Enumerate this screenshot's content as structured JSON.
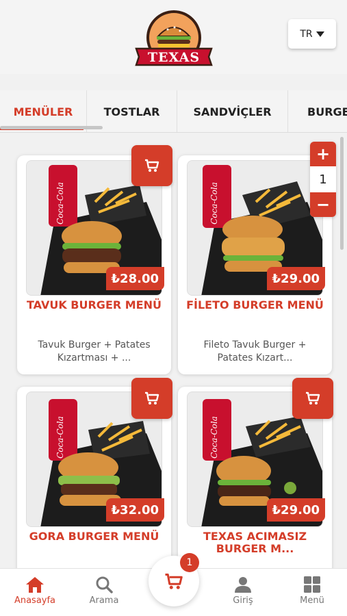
{
  "brand": {
    "name": "TEXAS"
  },
  "language": {
    "selected": "TR"
  },
  "tabs": [
    {
      "label": "MENÜLER",
      "active": true
    },
    {
      "label": "TOSTLAR",
      "active": false
    },
    {
      "label": "SANDVİÇLER",
      "active": false
    },
    {
      "label": "BURGE",
      "active": false
    }
  ],
  "products": [
    {
      "title": "TAVUK BURGER MENÜ",
      "price": "₺28.00",
      "description": "Tavuk Burger + Patates Kızartması + ..."
    },
    {
      "title": "FİLETO BURGER MENÜ",
      "price": "₺29.00",
      "description": "Fileto Tavuk Burger + Patates Kızart...",
      "quantity": "1"
    },
    {
      "title": "GORA BURGER MENÜ",
      "price": "₺32.00",
      "description": ""
    },
    {
      "title": "TEXAS ACIMASIZ BURGER M...",
      "price": "₺29.00",
      "description": ""
    }
  ],
  "bottom_nav": [
    {
      "label": "Anasayfa",
      "icon": "home-icon",
      "active": true
    },
    {
      "label": "Arama",
      "icon": "search-icon",
      "active": false
    },
    {
      "label": "Giriş",
      "icon": "user-icon",
      "active": false
    },
    {
      "label": "Menü",
      "icon": "grid-icon",
      "active": false
    }
  ],
  "cart": {
    "count": "1"
  },
  "colors": {
    "accent": "#d43d29"
  }
}
